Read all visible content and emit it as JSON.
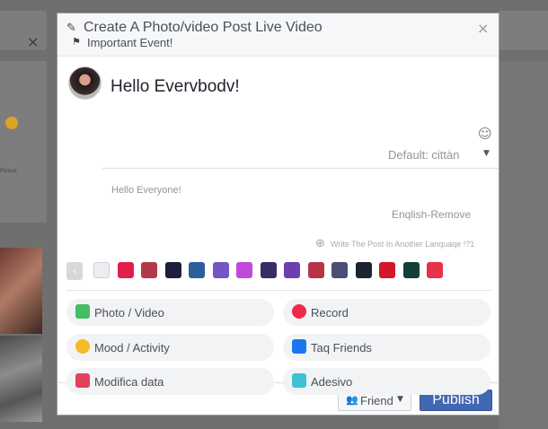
{
  "background": {
    "close_glyph": "×",
    "side_text": "Picture"
  },
  "modal": {
    "title": "Create A Photo/video Post Live Video",
    "subtitle": "Important Event!",
    "close_glyph": "×",
    "status_text": "Hello Evervbodv!",
    "audience_default": "Default: cittàn",
    "alt_language_text": "Hello Everyone!",
    "language_remove": "Enqlish-Remove",
    "add_language": "Write The Post In Another Lanquaqe !?1",
    "background_colors": [
      "#ebedf0",
      "#e41e4c",
      "#b23a48",
      "#1e1f3d",
      "#2c5f9e",
      "#7356c4",
      "#c349d9",
      "#3a2c66",
      "#6a3fb0",
      "#b8334a",
      "#4a4f73",
      "#1e2330",
      "#d4152a",
      "#10403a",
      "#e8314a"
    ],
    "options": [
      {
        "label": "Photo / Video",
        "icon": "photo-icon",
        "color": "#45bd62"
      },
      {
        "label": "Record",
        "icon": "location-pin-icon",
        "color": "#f02849"
      },
      {
        "label": "Mood / Activity",
        "icon": "emoji-icon",
        "color": "#f7b928"
      },
      {
        "label": "Taq Friends",
        "icon": "tag-friends-icon",
        "color": "#1877f2"
      },
      {
        "label": "Modifica data",
        "icon": "calendar-icon",
        "color": "#e4405f"
      },
      {
        "label": "Adesivo",
        "icon": "sticker-icon",
        "color": "#3ec1d3"
      }
    ],
    "friend_button": "Friend",
    "publish_button": "Publish"
  }
}
